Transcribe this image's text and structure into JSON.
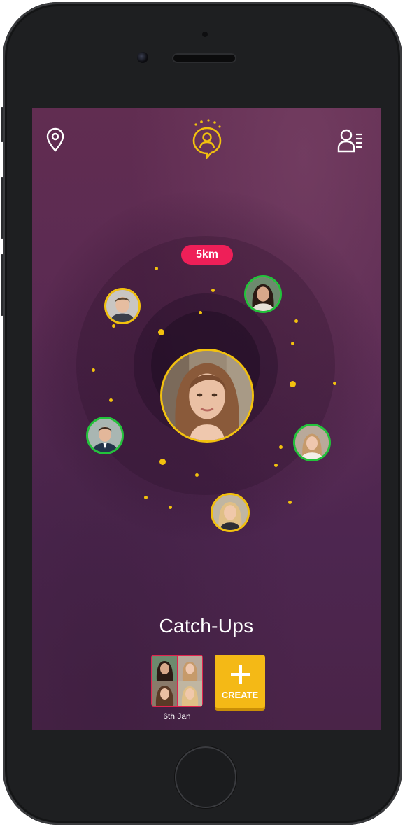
{
  "header": {
    "left_icon": "location-pin-icon",
    "center_icon": "profile-chat-icon",
    "right_icon": "contacts-list-icon"
  },
  "radar": {
    "distance_label": "5km",
    "center_avatar": "woman-center-avatar",
    "nearby": [
      {
        "name": "man-top-left-avatar",
        "status": "yellow"
      },
      {
        "name": "woman-top-right-avatar",
        "status": "green"
      },
      {
        "name": "man-left-avatar",
        "status": "green"
      },
      {
        "name": "woman-right-avatar",
        "status": "green"
      },
      {
        "name": "woman-bottom-avatar",
        "status": "yellow"
      }
    ]
  },
  "section_title": "Catch-Ups",
  "catchups": [
    {
      "date": "6th Jan"
    }
  ],
  "create_button": {
    "label": "CREATE",
    "icon": "plus-icon"
  },
  "colors": {
    "accent_yellow": "#f2c10e",
    "badge_red": "#ee1f58",
    "online_green": "#22c33b",
    "create_yellow": "#f4b916"
  }
}
